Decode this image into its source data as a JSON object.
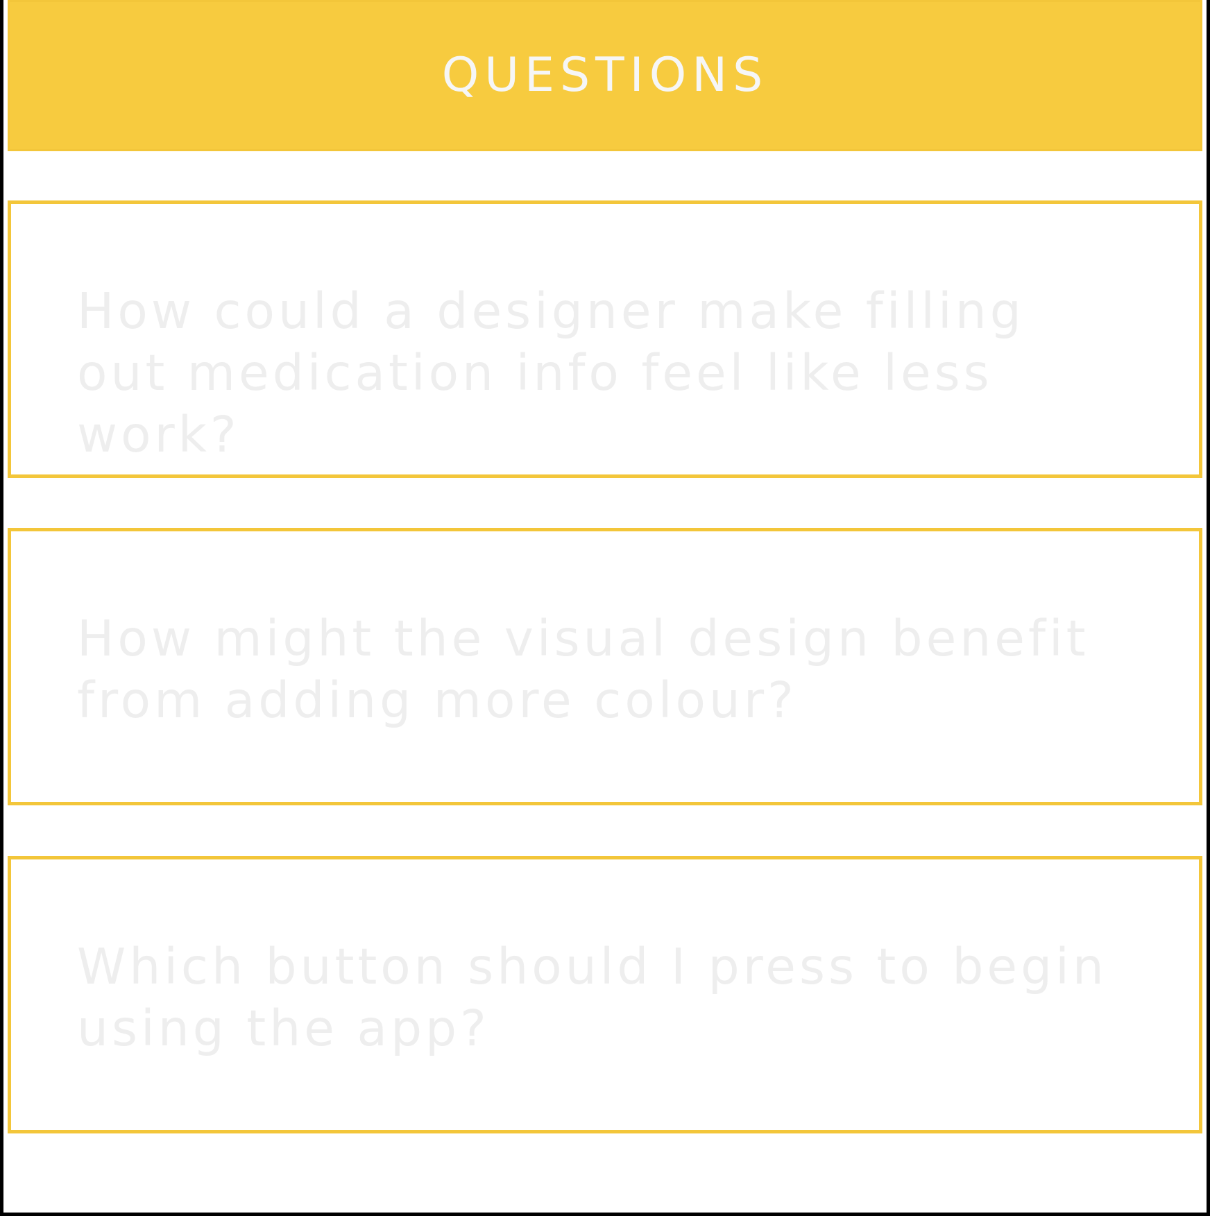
{
  "header": {
    "title": "QUESTIONS"
  },
  "questions": [
    {
      "text": "How could a designer make filling out medication info feel like less work?"
    },
    {
      "text": "How might the visual design benefit from adding more colour?"
    },
    {
      "text": "Which button should I press to begin using the app?"
    }
  ],
  "colors": {
    "accent": "#f7cb3f",
    "border": "#f3c63a",
    "question_text": "#eeeeee",
    "header_text": "#f6f6f6",
    "background": "#ffffff",
    "frame": "#000000"
  }
}
